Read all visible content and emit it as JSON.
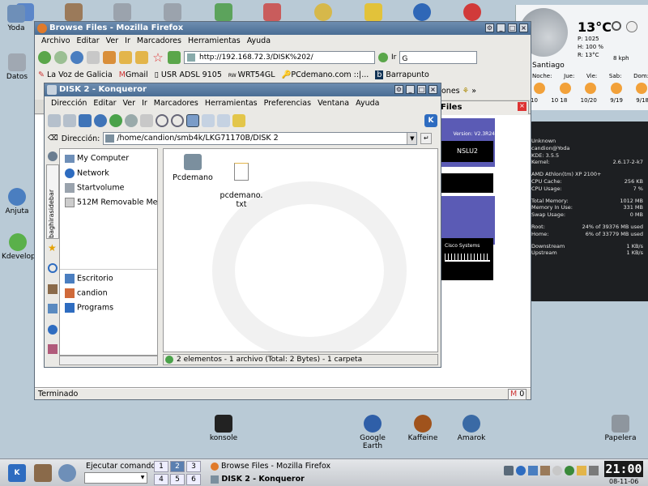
{
  "desktop": {
    "icons": [
      {
        "label": "Yoda"
      },
      {
        "label": "Datos"
      },
      {
        "label": "Anjuta"
      },
      {
        "label": "Kdevelop"
      },
      {
        "label": "konsole"
      },
      {
        "label": "Google Earth"
      },
      {
        "label": "Kaffeine"
      },
      {
        "label": "Amarok"
      },
      {
        "label": "Papelera"
      }
    ]
  },
  "weather": {
    "temp": "13°C",
    "p": "P: 1025",
    "h": "H: 100 %",
    "r": "R: 13°C",
    "wind": "8 kph",
    "city": "Santiago",
    "days": [
      "Noche:",
      "Jue:",
      "Vie:",
      "Sab:",
      "Dom:"
    ],
    "temps": [
      "10",
      "10 18",
      "10/20",
      "9/19",
      "9/18"
    ]
  },
  "sysmon": {
    "rows": [
      [
        "Unknown",
        ""
      ],
      [
        "candion@Yoda",
        ""
      ],
      [
        "KDE: 3.5.5",
        ""
      ],
      [
        "Kernel:",
        "2.6.17-2-k7"
      ],
      [
        "AMD Athlon(tm) XP 2100+",
        ""
      ],
      [
        "CPU Cache:",
        "256 KB"
      ],
      [
        "CPU Usage:",
        "7 %"
      ],
      [
        "Total Memory:",
        "1012 MB"
      ],
      [
        "Memory In Use:",
        "331 MB"
      ],
      [
        "Swap Usage:",
        "0 MB"
      ],
      [
        "Root:",
        "24% of 39376 MB used"
      ],
      [
        "Home:",
        "6% of 33779 MB used"
      ],
      [
        "Downstream",
        "1 KB/s"
      ],
      [
        "Upstream",
        "1 KB/s"
      ]
    ]
  },
  "firefox": {
    "title": "Browse Files - Mozilla Firefox",
    "menu": [
      "Archivo",
      "Editar",
      "Ver",
      "Ir",
      "Marcadores",
      "Herramientas",
      "Ayuda"
    ],
    "url": "http://192.168.72.3/DISK%202/",
    "go": "Ir",
    "bookmarks": [
      "La Voz de Galicia",
      "Gmail",
      "USR ADSL 9105",
      "WRT54GL",
      "PCdemano.com ::|...",
      "Barrapunto"
    ],
    "bookmarks_more": "ones",
    "tab_label": "Files",
    "status": "Terminado",
    "mail_count": "0",
    "page_version": "Version: V2.3R24",
    "page_model": "NSLU2",
    "page_brand": "Cisco Systems"
  },
  "konqueror": {
    "title": "DISK 2 - Konqueror",
    "menu": [
      "Dirección",
      "Editar",
      "Ver",
      "Ir",
      "Marcadores",
      "Herramientas",
      "Preferencias",
      "Ventana",
      "Ayuda"
    ],
    "address_label": "Dirección:",
    "address": "/home/candion/smb4k/LKG71170B/DISK 2",
    "side_tab": "baghirasidebar",
    "tree_top": [
      "My Computer",
      "Network",
      "Startvolume",
      "512M Removable Media"
    ],
    "tree_bottom": [
      "Escritorio",
      "candion",
      "Programs"
    ],
    "files": [
      "Pcdemano",
      "pcdemano.\ntxt"
    ],
    "status": "2 elementos - 1 archivo (Total: 2 Bytes) - 1 carpeta"
  },
  "taskbar": {
    "run_label": "Ejecutar comando",
    "pager": [
      "1",
      "2",
      "3",
      "4",
      "5",
      "6"
    ],
    "tasks": [
      "Browse Files - Mozilla Firefox",
      "DISK 2 - Konqueror"
    ],
    "clock": "21:00",
    "date": "08-11-06"
  }
}
